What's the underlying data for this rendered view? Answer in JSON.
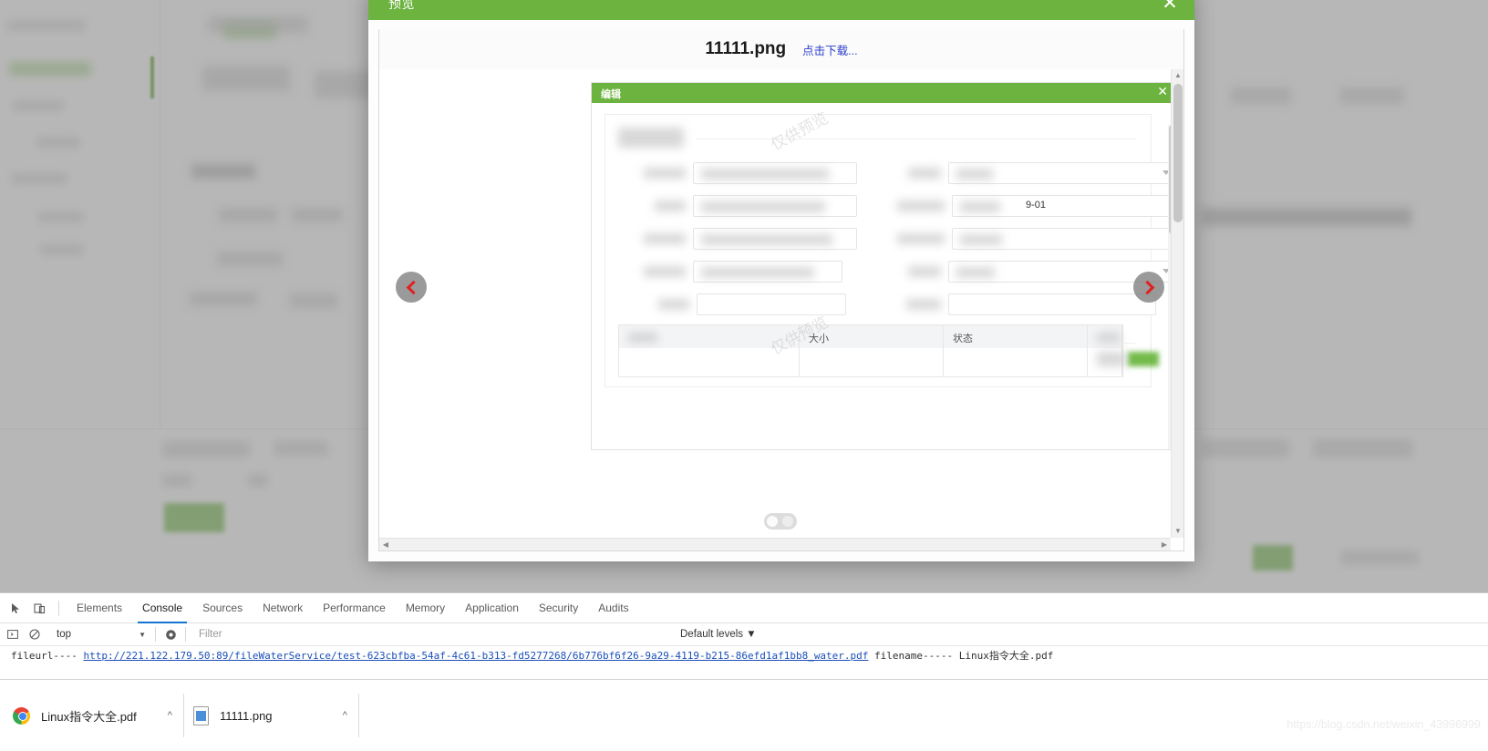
{
  "background_app": {
    "tabs": [
      "一般资质",
      "人员资质"
    ],
    "buttons": [
      "竞争对手资质",
      "公司资质",
      "区域房屋租赁合同"
    ],
    "section_title": "公司资质",
    "fields": [
      {
        "label": "公司名称:",
        "placeholder": "请选择"
      },
      {
        "label": "发证单位:",
        "placeholder": "请输入"
      }
    ],
    "table_headers": [
      "全选",
      "公司名称"
    ],
    "rows": [
      {
        "name": "北京神州绿盟科技有限公"
      }
    ]
  },
  "preview_modal": {
    "header_title": "预览",
    "close_icon": "close-icon",
    "file_name": "11111.png",
    "download_label": "点击下载...",
    "prev_icon": "chevron-left-icon",
    "next_icon": "chevron-right-icon"
  },
  "previewed_image": {
    "header_title": "编辑",
    "close_icon": "close-icon",
    "watermark": "仅供预览",
    "visible_value": "9-01",
    "table_headers": [
      "",
      "大小",
      "状态",
      ""
    ]
  },
  "devtools": {
    "inspect_icon": "inspect-element-icon",
    "device_icon": "device-toolbar-icon",
    "tabs": [
      {
        "label": "Elements",
        "active": false
      },
      {
        "label": "Console",
        "active": true
      },
      {
        "label": "Sources",
        "active": false
      },
      {
        "label": "Network",
        "active": false
      },
      {
        "label": "Performance",
        "active": false
      },
      {
        "label": "Memory",
        "active": false
      },
      {
        "label": "Application",
        "active": false
      },
      {
        "label": "Security",
        "active": false
      },
      {
        "label": "Audits",
        "active": false
      }
    ],
    "filter_bar": {
      "sidebar_icon": "show-console-sidebar-icon",
      "clear_icon": "clear-console-icon",
      "context": "top",
      "context_caret": "chevron-down-icon",
      "eye_icon": "live-expression-icon",
      "filter_placeholder": "Filter",
      "filter_value": "",
      "levels_label": "Default levels ▼"
    },
    "console_log": {
      "prefix": "fileurl---- ",
      "url": "http://221.122.179.50:89/fileWaterService/test-623cbfba-54af-4c61-b313-fd5277268/6b776bf6f26-9a29-4119-b215-86efd1af1bb8_water.pdf",
      "suffix": " filename----- Linux指令大全.pdf"
    }
  },
  "download_bar": {
    "items": [
      {
        "icon": "chrome-icon",
        "name": "Linux指令大全.pdf",
        "caret": "chevron-up-icon"
      },
      {
        "icon": "png-file-icon",
        "name": "11111.png",
        "caret": "chevron-up-icon"
      }
    ]
  },
  "watermark": {
    "text": "https://blog.csdn.net/weixin_43996999"
  }
}
